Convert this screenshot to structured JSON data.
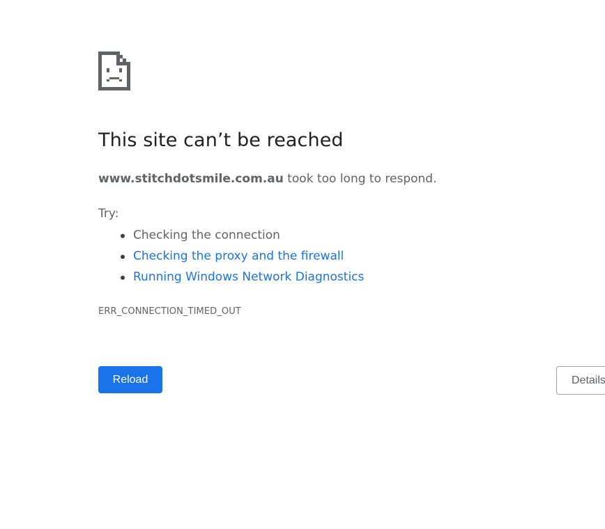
{
  "error": {
    "icon": "sad-document-icon",
    "title": "This site can’t be reached",
    "host": "www.stitchdotsmile.com.au",
    "message": " took too long to respond.",
    "try_label": "Try:",
    "suggestions": [
      {
        "label": "Checking the connection",
        "is_link": false
      },
      {
        "label": "Checking the proxy and the firewall",
        "is_link": true
      },
      {
        "label": "Running Windows Network Diagnostics",
        "is_link": true
      }
    ],
    "code": "ERR_CONNECTION_TIMED_OUT"
  },
  "buttons": {
    "reload_label": "Reload",
    "details_label": "Details"
  },
  "colors": {
    "primary": "#1a73e8",
    "text": "#5f6368",
    "heading": "#202124",
    "link": "#1a73e8"
  }
}
